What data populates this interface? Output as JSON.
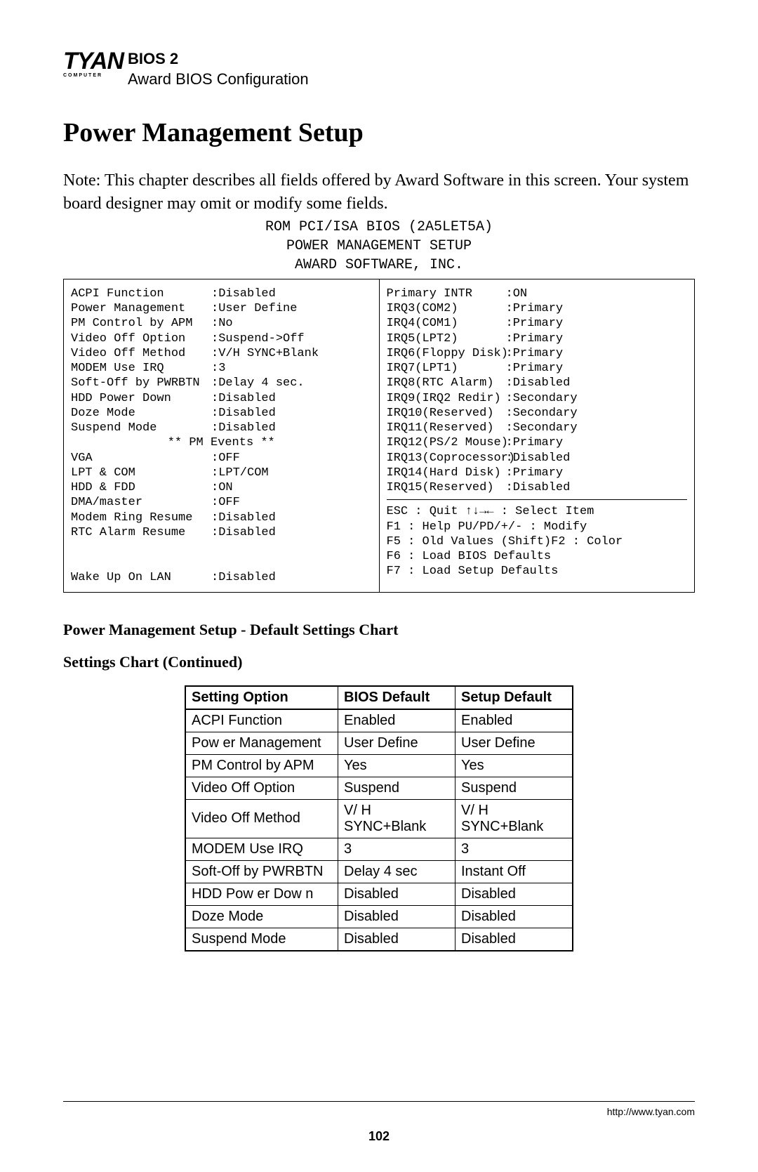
{
  "logo": {
    "top": "TYAN",
    "sub": "COMPUTER"
  },
  "header": {
    "line1": "BIOS 2",
    "line2": "Award BIOS Configuration"
  },
  "title": "Power Management Setup",
  "note": "Note: This chapter describes all fields offered by Award Software in this screen. Your system board designer may omit or modify some fields.",
  "bios_header": {
    "l1": "ROM PCI/ISA BIOS (2A5LET5A)",
    "l2": "POWER MANAGEMENT SETUP",
    "l3": "AWARD SOFTWARE, INC."
  },
  "left_col": [
    {
      "label": "ACPI Function",
      "val": "Disabled"
    },
    {
      "label": "Power Management",
      "val": "User Define"
    },
    {
      "label": "PM Control by APM",
      "val": "No"
    },
    {
      "label": "Video Off Option",
      "val": "Suspend->Off"
    },
    {
      "label": "Video Off Method",
      "val": "V/H SYNC+Blank"
    },
    {
      "label": "MODEM Use IRQ",
      "val": "3"
    },
    {
      "label": "Soft-Off by PWRBTN",
      "val": "Delay 4 sec."
    },
    {
      "label": "HDD Power Down",
      "val": "Disabled"
    },
    {
      "label": "Doze Mode",
      "val": "Disabled"
    },
    {
      "label": "Suspend Mode",
      "val": "Disabled"
    }
  ],
  "pm_events_label": "** PM Events **",
  "left_col2": [
    {
      "label": "VGA",
      "val": "OFF"
    },
    {
      "label": "LPT & COM",
      "val": "LPT/COM"
    },
    {
      "label": "HDD & FDD",
      "val": "ON"
    },
    {
      "label": "DMA/master",
      "val": "OFF"
    },
    {
      "label": "Modem Ring Resume",
      "val": "Disabled"
    },
    {
      "label": "RTC Alarm Resume",
      "val": "Disabled"
    }
  ],
  "left_col3": [
    {
      "label": "Wake Up On LAN",
      "val": "Disabled"
    }
  ],
  "right_col": [
    {
      "label": "Primary INTR",
      "val": "ON"
    },
    {
      "label": "IRQ3(COM2)",
      "val": "Primary"
    },
    {
      "label": "IRQ4(COM1)",
      "val": "Primary"
    },
    {
      "label": "IRQ5(LPT2)",
      "val": "Primary"
    },
    {
      "label": "IRQ6(Floppy Disk)",
      "val": "Primary"
    },
    {
      "label": "IRQ7(LPT1)",
      "val": "Primary"
    },
    {
      "label": "IRQ8(RTC Alarm)",
      "val": "Disabled"
    },
    {
      "label": "IRQ9(IRQ2 Redir)",
      "val": "Secondary"
    },
    {
      "label": "IRQ10(Reserved)",
      "val": "Secondary"
    },
    {
      "label": "IRQ11(Reserved)",
      "val": "Secondary"
    },
    {
      "label": "IRQ12(PS/2 Mouse)",
      "val": "Primary"
    },
    {
      "label": "IRQ13(Coprocessor)",
      "val": "Disabled"
    },
    {
      "label": "IRQ14(Hard Disk)",
      "val": "Primary"
    },
    {
      "label": "IRQ15(Reserved)",
      "val": "Disabled"
    }
  ],
  "help": {
    "l1": "ESC : Quit    ↑↓→← : Select Item",
    "l2": "F1 : Help       PU/PD/+/- : Modify",
    "l3": "F5 : Old Values  (Shift)F2 : Color",
    "l4": "F6 : Load BIOS  Defaults",
    "l5": "F7 : Load Setup Defaults"
  },
  "sub1": "Power Management Setup - Default Settings Chart",
  "sub2": "Settings Chart (Continued)",
  "table": {
    "headers": [
      "Setting Option",
      "BIOS Default",
      "Setup Default"
    ],
    "rows": [
      [
        "ACPI Function",
        "Enabled",
        "Enabled"
      ],
      [
        "Pow er Management",
        "User Define",
        "User Define"
      ],
      [
        "PM Control by APM",
        "Yes",
        "Yes"
      ],
      [
        "Video Off Option",
        "Suspend",
        "Suspend"
      ],
      [
        "Video Off Method",
        "V/ H SYNC+Blank",
        "V/ H SYNC+Blank"
      ],
      [
        "MODEM Use IRQ",
        "3",
        "3"
      ],
      [
        "Soft-Off by PWRBTN",
        "Delay 4 sec",
        "Instant Off"
      ],
      [
        "HDD Pow er Dow n",
        "Disabled",
        "Disabled"
      ],
      [
        "Doze Mode",
        "Disabled",
        "Disabled"
      ],
      [
        "Suspend Mode",
        "Disabled",
        "Disabled"
      ]
    ]
  },
  "footer_url": "http://www.tyan.com",
  "page_number": "102"
}
